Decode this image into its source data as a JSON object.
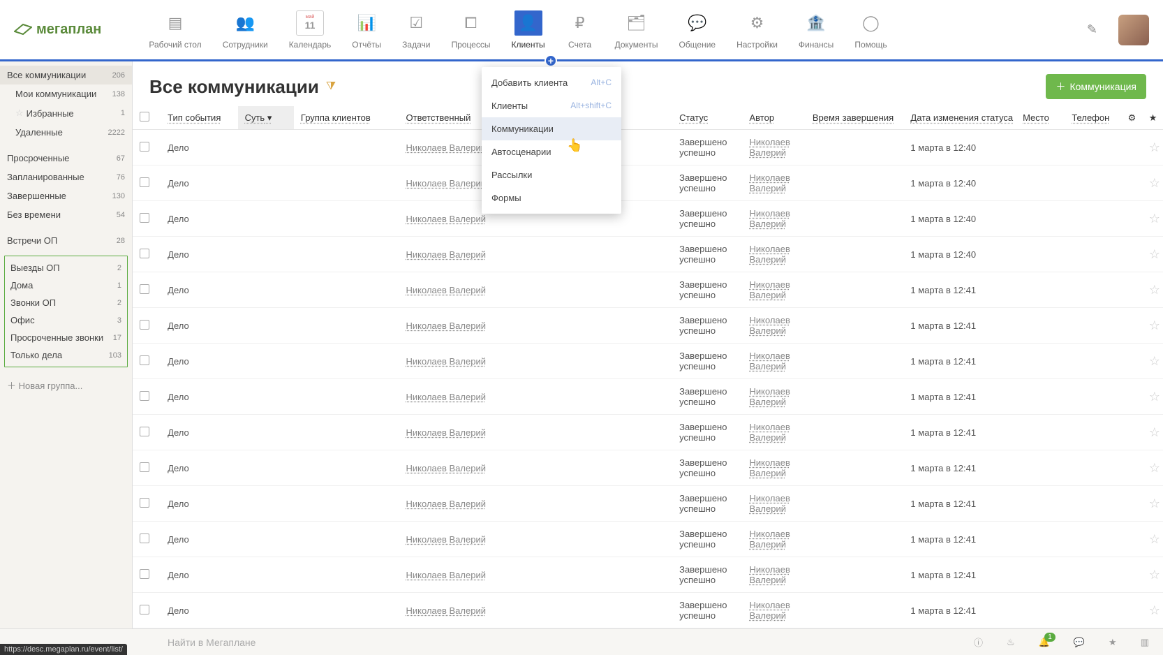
{
  "logo": "мегаплан",
  "nav": [
    {
      "label": "Рабочий стол"
    },
    {
      "label": "Сотрудники"
    },
    {
      "label": "Календарь",
      "sub": "11",
      "top": "май"
    },
    {
      "label": "Отчёты"
    },
    {
      "label": "Задачи"
    },
    {
      "label": "Процессы"
    },
    {
      "label": "Клиенты",
      "active": true
    },
    {
      "label": "Счета"
    },
    {
      "label": "Документы"
    },
    {
      "label": "Общение"
    },
    {
      "label": "Настройки"
    },
    {
      "label": "Финансы"
    },
    {
      "label": "Помощь"
    }
  ],
  "sidebar": {
    "top": [
      {
        "label": "Все коммуникации",
        "count": "206",
        "sel": true,
        "indent": false
      },
      {
        "label": "Мои коммуникации",
        "count": "138",
        "indent": true
      },
      {
        "label": "Избранные",
        "count": "1",
        "indent": true,
        "star": true
      },
      {
        "label": "Удаленные",
        "count": "2222",
        "indent": true
      }
    ],
    "filters": [
      {
        "label": "Просроченные",
        "count": "67"
      },
      {
        "label": "Запланированные",
        "count": "76"
      },
      {
        "label": "Завершенные",
        "count": "130"
      },
      {
        "label": "Без времени",
        "count": "54"
      }
    ],
    "group1": [
      {
        "label": "Встречи ОП",
        "count": "28"
      }
    ],
    "boxed": [
      {
        "label": "Выезды ОП",
        "count": "2"
      },
      {
        "label": "Дома",
        "count": "1"
      },
      {
        "label": "Звонки ОП",
        "count": "2"
      },
      {
        "label": "Офис",
        "count": "3"
      },
      {
        "label": "Просроченные звонки",
        "count": "17"
      },
      {
        "label": "Только дела",
        "count": "103"
      }
    ],
    "add": "Новая группа..."
  },
  "page": {
    "title": "Все коммуникации",
    "add_button": "Коммуникация"
  },
  "columns": {
    "type": "Тип события",
    "sub": "Суть",
    "grp": "Группа клиентов",
    "resp": "Ответственный",
    "stat": "Статус",
    "auth": "Автор",
    "time": "Время завершения",
    "date": "Дата изменения статуса",
    "place": "Место",
    "tel": "Телефон"
  },
  "rows": [
    {
      "type": "Дело",
      "resp": "Николаев Валерий",
      "stat": "Завершено успешно",
      "auth": "Николаев Валерий",
      "date": "1 марта в 12:40"
    },
    {
      "type": "Дело",
      "resp": "Николаев Валерий",
      "stat": "Завершено успешно",
      "auth": "Николаев Валерий",
      "date": "1 марта в 12:40"
    },
    {
      "type": "Дело",
      "resp": "Николаев Валерий",
      "stat": "Завершено успешно",
      "auth": "Николаев Валерий",
      "date": "1 марта в 12:40"
    },
    {
      "type": "Дело",
      "resp": "Николаев Валерий",
      "stat": "Завершено успешно",
      "auth": "Николаев Валерий",
      "date": "1 марта в 12:40"
    },
    {
      "type": "Дело",
      "resp": "Николаев Валерий",
      "stat": "Завершено успешно",
      "auth": "Николаев Валерий",
      "date": "1 марта в 12:41"
    },
    {
      "type": "Дело",
      "resp": "Николаев Валерий",
      "stat": "Завершено успешно",
      "auth": "Николаев Валерий",
      "date": "1 марта в 12:41"
    },
    {
      "type": "Дело",
      "resp": "Николаев Валерий",
      "stat": "Завершено успешно",
      "auth": "Николаев Валерий",
      "date": "1 марта в 12:41"
    },
    {
      "type": "Дело",
      "resp": "Николаев Валерий",
      "stat": "Завершено успешно",
      "auth": "Николаев Валерий",
      "date": "1 марта в 12:41"
    },
    {
      "type": "Дело",
      "resp": "Николаев Валерий",
      "stat": "Завершено успешно",
      "auth": "Николаев Валерий",
      "date": "1 марта в 12:41"
    },
    {
      "type": "Дело",
      "resp": "Николаев Валерий",
      "stat": "Завершено успешно",
      "auth": "Николаев Валерий",
      "date": "1 марта в 12:41"
    },
    {
      "type": "Дело",
      "resp": "Николаев Валерий",
      "stat": "Завершено успешно",
      "auth": "Николаев Валерий",
      "date": "1 марта в 12:41"
    },
    {
      "type": "Дело",
      "resp": "Николаев Валерий",
      "stat": "Завершено успешно",
      "auth": "Николаев Валерий",
      "date": "1 марта в 12:41"
    },
    {
      "type": "Дело",
      "resp": "Николаев Валерий",
      "stat": "Завершено успешно",
      "auth": "Николаев Валерий",
      "date": "1 марта в 12:41"
    },
    {
      "type": "Дело",
      "resp": "Николаев Валерий",
      "stat": "Завершено успешно",
      "auth": "Николаев Валерий",
      "date": "1 марта в 12:41"
    }
  ],
  "dropdown": [
    {
      "label": "Добавить клиента",
      "short": "Alt+C"
    },
    {
      "label": "Клиенты",
      "short": "Alt+shift+C"
    },
    {
      "label": "Коммуникации",
      "hov": true
    },
    {
      "label": "Автосценарии"
    },
    {
      "label": "Рассылки"
    },
    {
      "label": "Формы"
    }
  ],
  "footer": {
    "search": "Найти в Мегаплане",
    "bell_count": "1",
    "status": "https://desc.megaplan.ru/event/list/"
  }
}
